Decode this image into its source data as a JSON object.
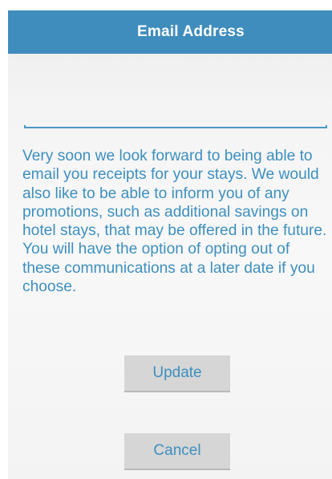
{
  "header": {
    "title": "Email Address"
  },
  "email_input": {
    "value": "",
    "placeholder": ""
  },
  "message": {
    "text": "Very soon we look forward to being able to email you receipts for your stays. We would also like to be able to inform you of any promotions, such as additional savings on hotel stays, that may be offered in the future.  You will have the option of opting out of these communications at a later date if you choose."
  },
  "buttons": {
    "update_label": "Update",
    "cancel_label": "Cancel"
  },
  "colors": {
    "header_background": "#3f8dbd",
    "accent_text": "#3d8fbf",
    "button_background": "#d6d6d6"
  }
}
